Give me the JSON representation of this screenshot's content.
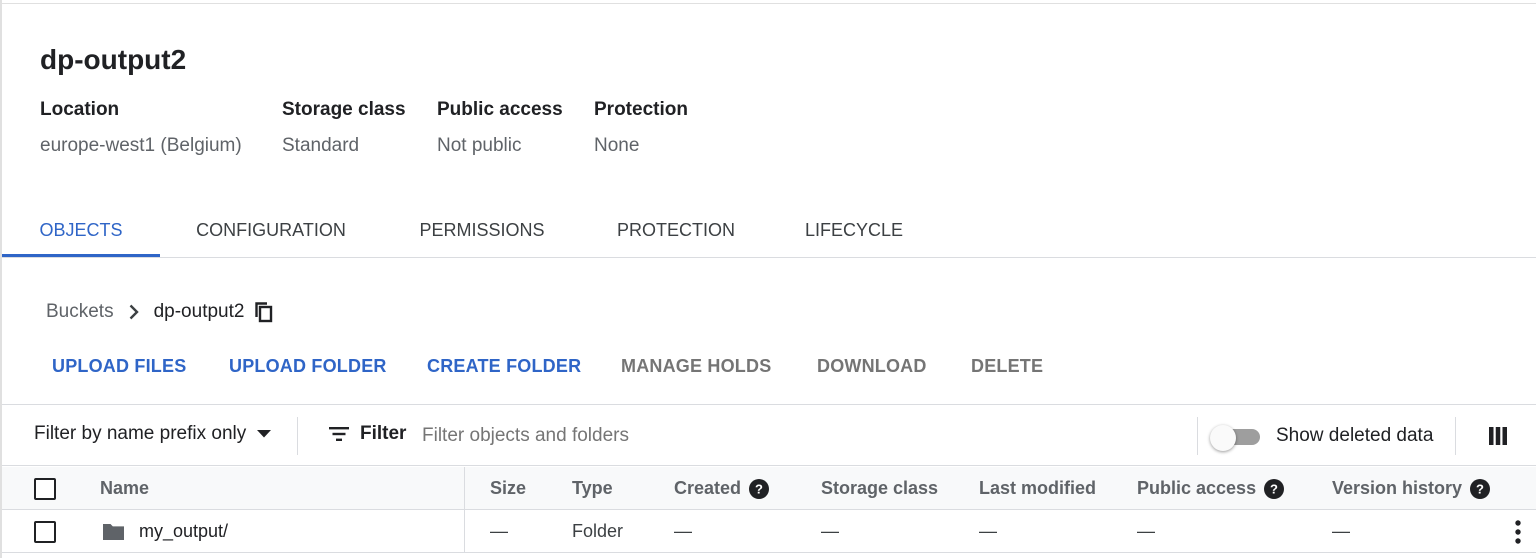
{
  "bucket": {
    "title": "dp-output2"
  },
  "meta": [
    {
      "label": "Location",
      "value": "europe-west1 (Belgium)"
    },
    {
      "label": "Storage class",
      "value": "Standard"
    },
    {
      "label": "Public access",
      "value": "Not public"
    },
    {
      "label": "Protection",
      "value": "None"
    }
  ],
  "tabs": [
    {
      "label": "OBJECTS",
      "active": true
    },
    {
      "label": "CONFIGURATION"
    },
    {
      "label": "PERMISSIONS"
    },
    {
      "label": "PROTECTION"
    },
    {
      "label": "LIFECYCLE"
    }
  ],
  "breadcrumb": {
    "root": "Buckets",
    "current": "dp-output2",
    "icons": {
      "separator": "chevron-right-icon",
      "copy": "copy-icon"
    }
  },
  "actions": {
    "upload_files": "UPLOAD FILES",
    "upload_folder": "UPLOAD FOLDER",
    "create_folder": "CREATE FOLDER",
    "manage_holds": "MANAGE HOLDS",
    "download": "DOWNLOAD",
    "delete": "DELETE"
  },
  "filterbar": {
    "prefix_mode": "Filter by name prefix only",
    "filter_label": "Filter",
    "filter_placeholder": "Filter objects and folders",
    "show_deleted_label": "Show deleted data",
    "show_deleted_on": false
  },
  "table": {
    "columns": {
      "name": "Name",
      "size": "Size",
      "type": "Type",
      "created": "Created",
      "storage_class": "Storage class",
      "last_modified": "Last modified",
      "public_access": "Public access",
      "version_history": "Version history"
    },
    "rows": [
      {
        "name": "my_output/",
        "size": "—",
        "type": "Folder",
        "created": "—",
        "storage_class": "—",
        "last_modified": "—",
        "public_access": "—",
        "version_history": "—"
      }
    ]
  },
  "colors": {
    "accent": "#2f65c7",
    "disabled": "#757575",
    "border": "#dadce0",
    "header_bg": "#f8f9fa"
  }
}
